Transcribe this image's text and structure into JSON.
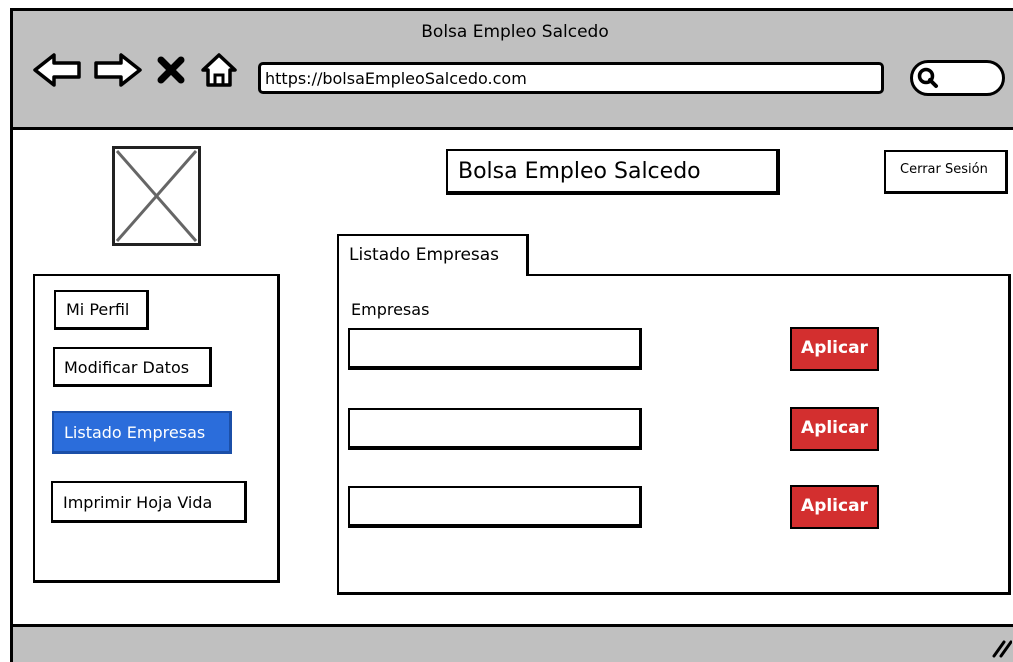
{
  "window": {
    "title": "Bolsa Empleo Salcedo"
  },
  "browser": {
    "nav_icons": [
      "back-arrow-icon",
      "forward-arrow-icon",
      "close-icon",
      "home-icon"
    ],
    "url": "https://bolsaEmpleoSalcedo.com",
    "search_icon": "search-icon"
  },
  "header": {
    "logo": "image-placeholder-icon",
    "app_title": "Bolsa Empleo Salcedo",
    "logout_label": "Cerrar Sesión"
  },
  "sidebar": {
    "items": [
      {
        "label": "Mi Perfil",
        "active": false
      },
      {
        "label": "Modificar Datos",
        "active": false
      },
      {
        "label": "Listado Empresas",
        "active": true
      },
      {
        "label": "Imprimir Hoja Vida",
        "active": false
      }
    ]
  },
  "main": {
    "tab_label": "Listado Empresas",
    "section_label": "Empresas",
    "rows": [
      {
        "company_value": "",
        "apply_label": "Aplicar"
      },
      {
        "company_value": "",
        "apply_label": "Aplicar"
      },
      {
        "company_value": "",
        "apply_label": "Aplicar"
      }
    ]
  },
  "colors": {
    "chrome": "#c0c0c0",
    "active_nav": "#2b6ddb",
    "apply_button": "#d32f2f"
  }
}
